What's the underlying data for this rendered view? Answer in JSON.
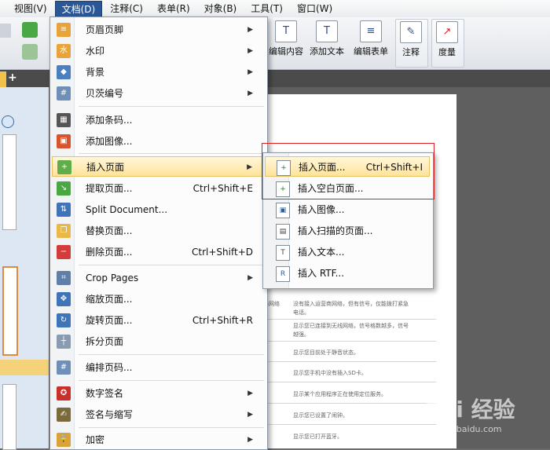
{
  "menubar": {
    "items": [
      {
        "label": "视图(V)"
      },
      {
        "label": "文档(D)"
      },
      {
        "label": "注释(C)"
      },
      {
        "label": "表单(R)"
      },
      {
        "label": "对象(B)"
      },
      {
        "label": "工具(T)"
      },
      {
        "label": "窗口(W)"
      }
    ]
  },
  "toolbar": {
    "edit_content": "编辑内容",
    "add_text": "添加文本",
    "edit_form": "编辑表单",
    "annotate": "注释",
    "measure": "度量"
  },
  "document_menu": {
    "items": [
      {
        "label": "页眉页脚",
        "submenu": true
      },
      {
        "label": "水印",
        "submenu": true
      },
      {
        "label": "背景",
        "submenu": true
      },
      {
        "label": "贝茨编号",
        "submenu": true
      },
      {
        "label": "添加条码..."
      },
      {
        "label": "添加图像..."
      },
      {
        "label": "插入页面",
        "submenu": true
      },
      {
        "label": "提取页面...",
        "shortcut": "Ctrl+Shift+E"
      },
      {
        "label": "Split Document..."
      },
      {
        "label": "替换页面..."
      },
      {
        "label": "删除页面...",
        "shortcut": "Ctrl+Shift+D"
      },
      {
        "label": "Crop Pages",
        "submenu": true
      },
      {
        "label": "缩放页面..."
      },
      {
        "label": "旋转页面...",
        "shortcut": "Ctrl+Shift+R"
      },
      {
        "label": "拆分页面"
      },
      {
        "label": "编排页码..."
      },
      {
        "label": "数字签名",
        "submenu": true
      },
      {
        "label": "签名与缩写",
        "submenu": true
      },
      {
        "label": "加密",
        "submenu": true
      }
    ]
  },
  "insert_submenu": {
    "items": [
      {
        "label": "插入页面...",
        "shortcut": "Ctrl+Shift+I"
      },
      {
        "label": "插入空白页面..."
      },
      {
        "label": "插入图像..."
      },
      {
        "label": "插入扫描的页面..."
      },
      {
        "label": "插入文本..."
      },
      {
        "label": "插入 RTF..."
      }
    ]
  },
  "document_page": {
    "lines": [
      {
        "text": "没有接入运营商网络，但有信号，仅能拨打紧急"
      },
      {
        "text": "电话。"
      },
      {
        "text": "显示您已连接到无线网络，信号格数越多，信号"
      },
      {
        "text": "越强。"
      },
      {
        "text": "显示您目前处于静音状态。"
      },
      {
        "text": "显示您手机中没有插入SD卡。"
      },
      {
        "text": "显示某个应用程序正在使用定位服务。"
      },
      {
        "text": "显示您已设置了闹钟。"
      },
      {
        "text": "显示您已打开蓝牙。"
      }
    ],
    "left_fragment": "局网络"
  },
  "watermark": {
    "brand": "Bai 经验",
    "url": "jingyan.baidu.com"
  },
  "colors": {
    "highlight": "#ffe39a",
    "accent": "#2b5797",
    "annotation_box": "#e02020"
  }
}
